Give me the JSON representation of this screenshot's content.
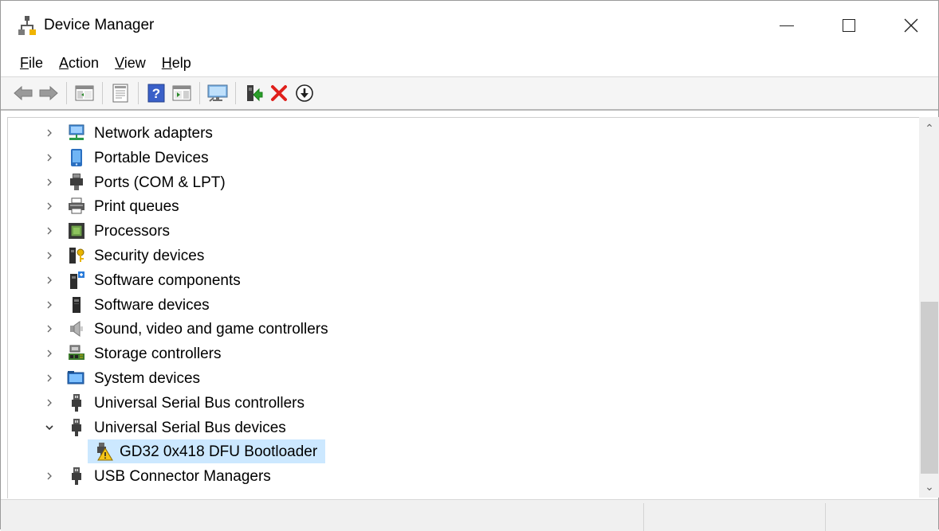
{
  "window": {
    "title": "Device Manager"
  },
  "menu": [
    {
      "label": "File"
    },
    {
      "label": "Action"
    },
    {
      "label": "View"
    },
    {
      "label": "Help"
    }
  ],
  "toolbar": {
    "buttons": [
      "back-icon",
      "forward-icon",
      "show-hide-console-tree-icon",
      "properties-icon",
      "help-icon",
      "run-icon",
      "scan-hardware-icon",
      "update-driver-icon",
      "uninstall-icon",
      "disable-device-icon"
    ]
  },
  "tree": {
    "items": [
      {
        "label": "Network adapters",
        "icon": "network-adapter-icon",
        "expanded": false
      },
      {
        "label": "Portable Devices",
        "icon": "portable-device-icon",
        "expanded": false
      },
      {
        "label": "Ports (COM & LPT)",
        "icon": "port-icon",
        "expanded": false
      },
      {
        "label": "Print queues",
        "icon": "printer-icon",
        "expanded": false
      },
      {
        "label": "Processors",
        "icon": "processor-icon",
        "expanded": false
      },
      {
        "label": "Security devices",
        "icon": "security-device-icon",
        "expanded": false
      },
      {
        "label": "Software components",
        "icon": "software-component-icon",
        "expanded": false
      },
      {
        "label": "Software devices",
        "icon": "software-device-icon",
        "expanded": false
      },
      {
        "label": "Sound, video and game controllers",
        "icon": "speaker-icon",
        "expanded": false
      },
      {
        "label": "Storage controllers",
        "icon": "storage-controller-icon",
        "expanded": false
      },
      {
        "label": "System devices",
        "icon": "system-device-icon",
        "expanded": false
      },
      {
        "label": "Universal Serial Bus controllers",
        "icon": "usb-plug-icon",
        "expanded": false
      },
      {
        "label": "Universal Serial Bus devices",
        "icon": "usb-plug-icon",
        "expanded": true
      },
      {
        "label": "GD32 0x418 DFU Bootloader",
        "icon": "warning-device-icon",
        "child": true,
        "selected": true
      },
      {
        "label": "USB Connector Managers",
        "icon": "usb-plug-icon",
        "expanded": false
      }
    ]
  },
  "colors": {
    "selection": "#cce8ff",
    "warning": "#f5c518",
    "uninstall_red": "#e0201b"
  }
}
